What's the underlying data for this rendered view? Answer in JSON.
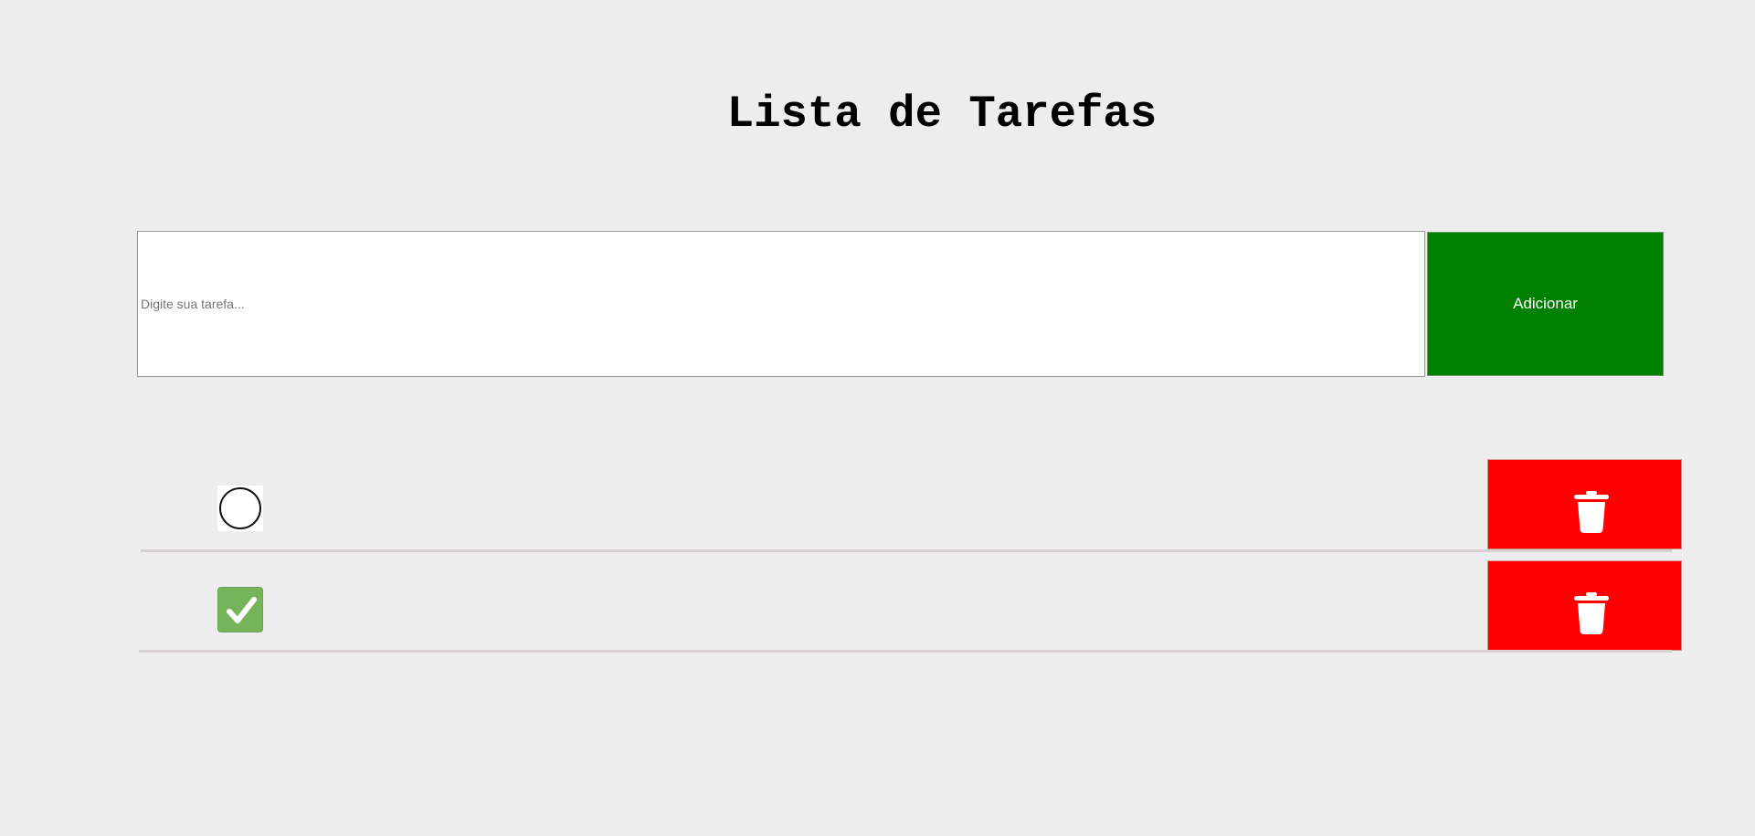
{
  "header": {
    "title": "Lista de Tarefas"
  },
  "form": {
    "placeholder": "Digite sua tarefa...",
    "value": "",
    "add_label": "Adicionar"
  },
  "tasks": [
    {
      "text": "",
      "completed": false,
      "check_icon": "circle-icon",
      "delete_icon": "trash-icon"
    },
    {
      "text": "",
      "completed": true,
      "check_icon": "checkbox-checked-icon",
      "delete_icon": "trash-icon"
    }
  ],
  "colors": {
    "background": "#ededed",
    "add_button": "#008000",
    "delete_button": "#ff0000",
    "checked": "#76b45a",
    "divider": "#d6d1d1"
  }
}
